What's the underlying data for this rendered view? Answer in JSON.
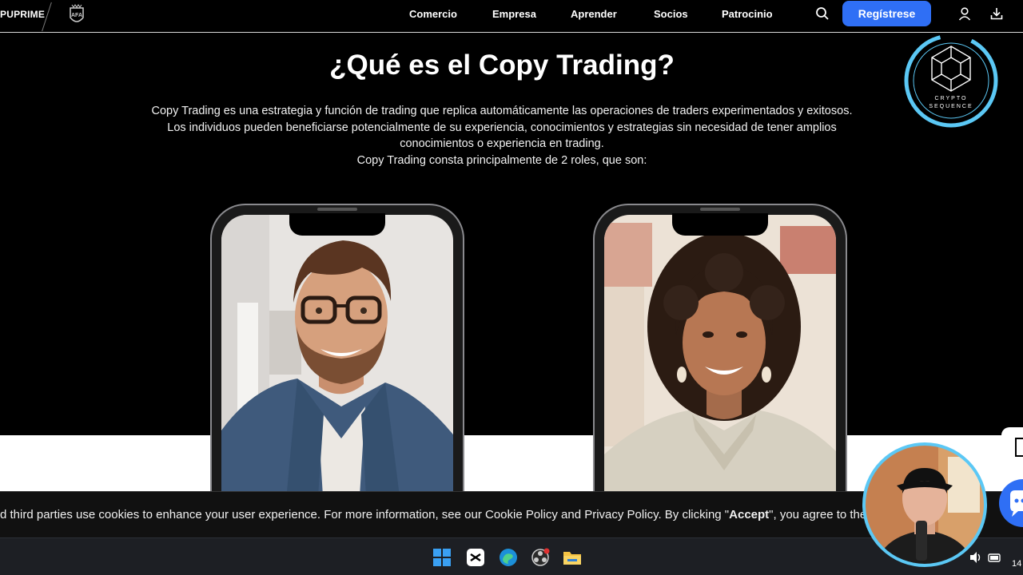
{
  "navbar": {
    "brand": "PUPRIME",
    "links": [
      "Comercio",
      "Empresa",
      "Aprender",
      "Socios",
      "Patrocinio"
    ],
    "register_label": "Regístrese"
  },
  "hero": {
    "title": "¿Qué es el Copy Trading?",
    "lines": [
      "Copy Trading es una estrategia y función de trading que replica automáticamente las operaciones de traders experimentados y exitosos.",
      "Los individuos pueden beneficiarse potencialmente de su experiencia, conocimientos y estrategias sin necesidad de tener amplios",
      "conocimientos o experiencia en trading.",
      "Copy Trading consta principalmente de 2 roles, que son:"
    ]
  },
  "cookie": {
    "before": "d third parties use cookies to enhance your user experience. For more information, see our Cookie Policy and Privacy Policy. By clicking \"",
    "accept": "Accept",
    "after": "\", you agree to the"
  },
  "overlay": {
    "logo_line1": "CRYPTO",
    "logo_line2": "SEQUENCE"
  },
  "taskbar": {
    "clock": "14"
  },
  "colors": {
    "accent": "#2f6ff5",
    "background": "#000000",
    "overlay_ring": "#5bc8f5"
  },
  "icons": [
    "search-icon",
    "user-icon",
    "download-icon",
    "windows-start-icon",
    "capcut-icon",
    "edge-icon",
    "obs-icon",
    "file-explorer-icon",
    "volume-icon",
    "battery-icon",
    "chat-icon"
  ]
}
